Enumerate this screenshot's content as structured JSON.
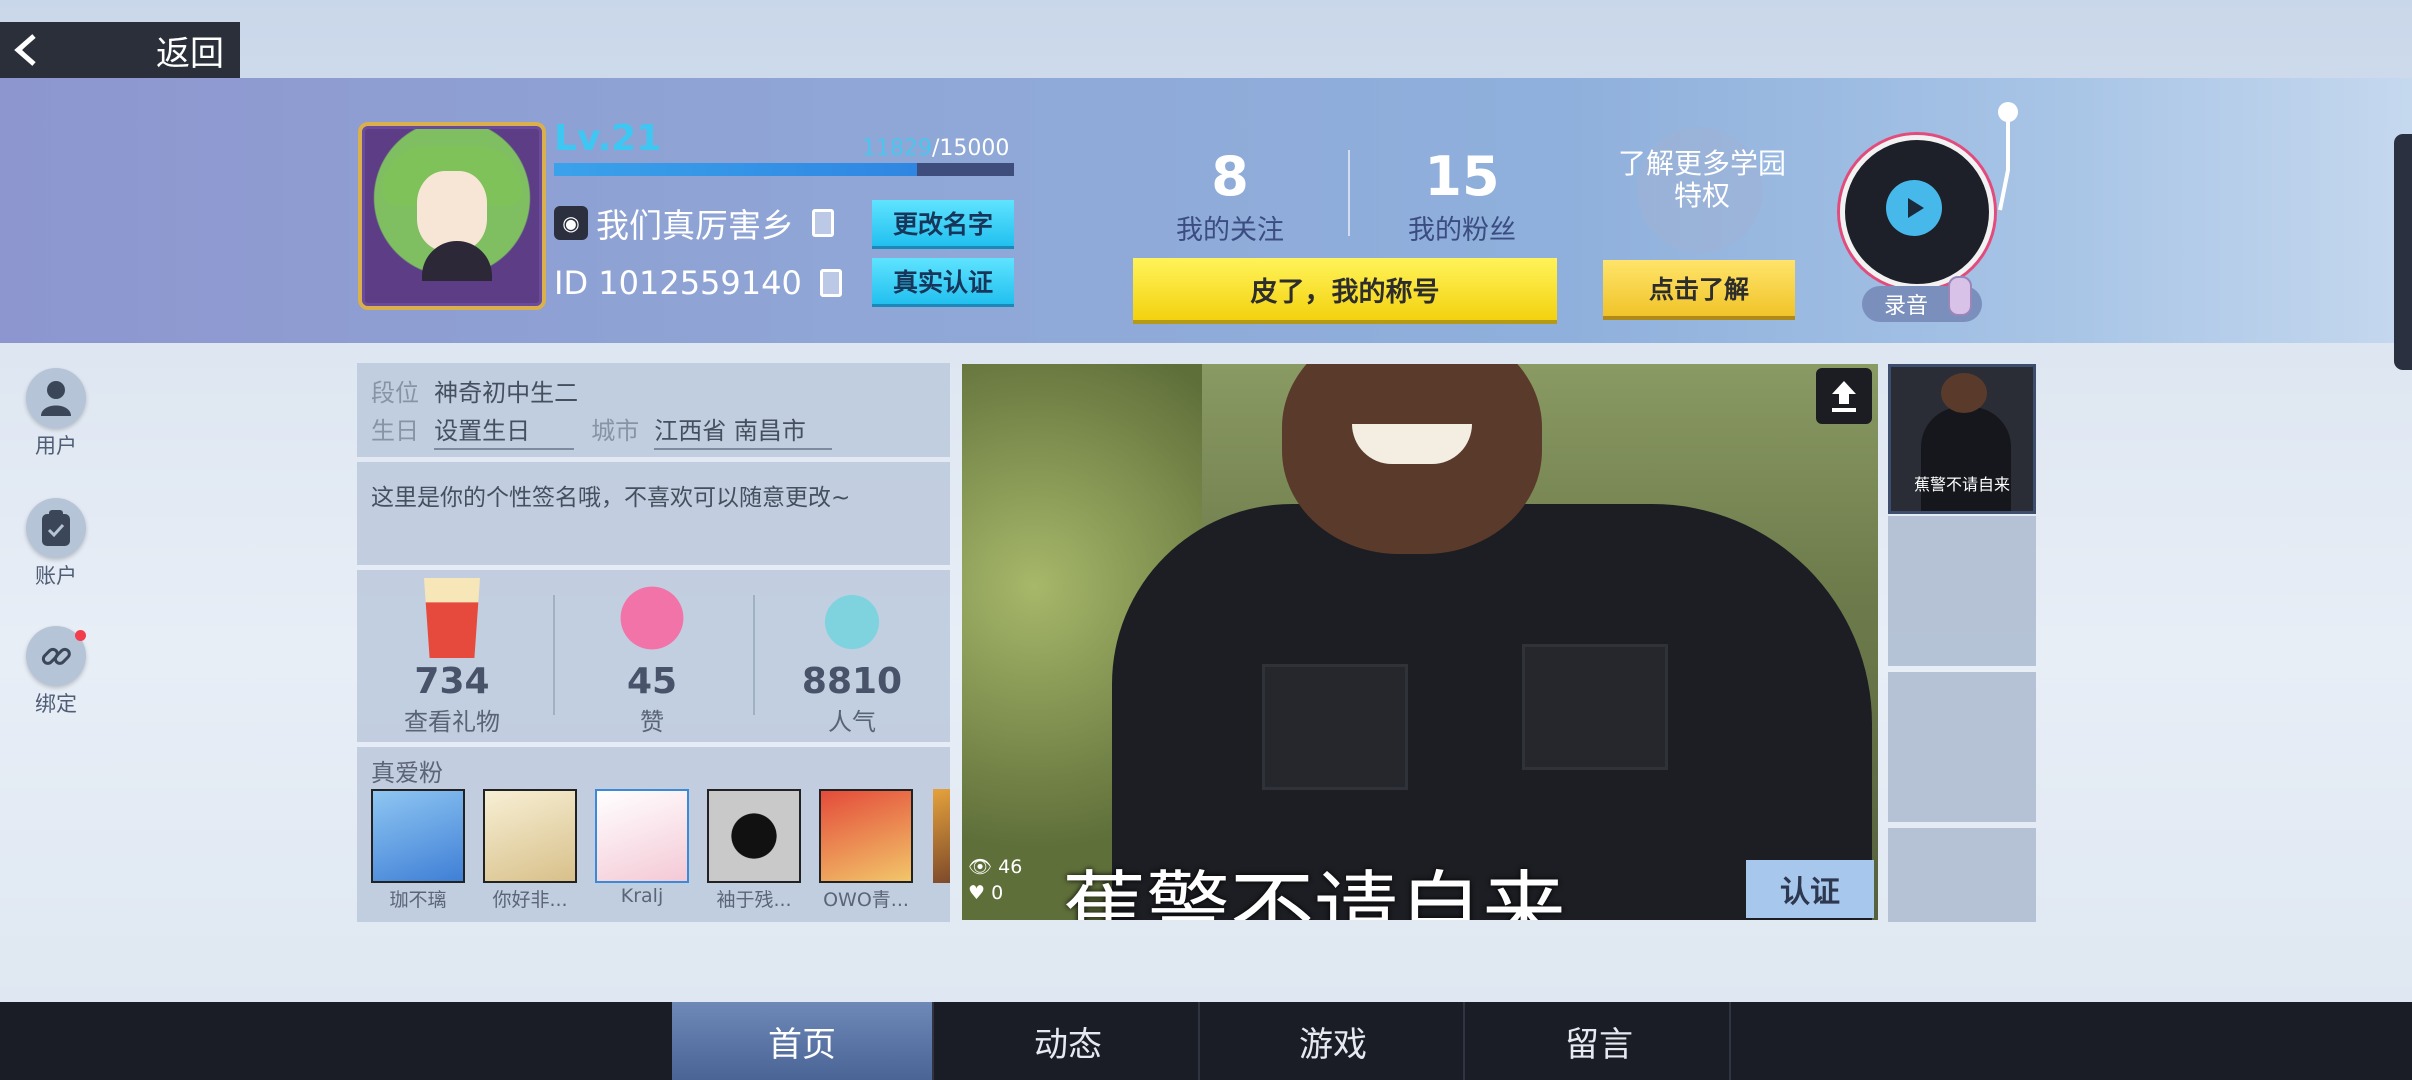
{
  "back": {
    "label": "返回"
  },
  "profile": {
    "level": "Lv.21",
    "xp_current": "11829",
    "xp_max": "/15000",
    "xp_fraction": 0.79,
    "name": "我们真厉害乡",
    "id": "ID 1012559140",
    "rename_label": "更改名字",
    "verify_label": "真实认证"
  },
  "stats": {
    "following_count": "8",
    "following_label": "我的关注",
    "fans_count": "15",
    "fans_label": "我的粉丝",
    "title_button": "皮了，我的称号"
  },
  "privilege": {
    "text": "了解更多学园特权",
    "button": "点击了解"
  },
  "record": {
    "label": "录音"
  },
  "sidebar": {
    "items": [
      {
        "label": "用户",
        "icon": "user-icon"
      },
      {
        "label": "账户",
        "icon": "clipboard-icon"
      },
      {
        "label": "绑定",
        "icon": "link-icon"
      }
    ]
  },
  "info": {
    "rank_label": "段位",
    "rank_value": "神奇初中生二",
    "birthday_label": "生日",
    "birthday_value": "设置生日",
    "city_label": "城市",
    "city_value": "江西省 南昌市",
    "signature": "这里是你的个性签名哦，不喜欢可以随意更改~"
  },
  "gifts": [
    {
      "value": "734",
      "label": "查看礼物",
      "icon": "popcorn-icon"
    },
    {
      "value": "45",
      "label": "赞",
      "icon": "heart-mascot-icon"
    },
    {
      "value": "8810",
      "label": "人气",
      "icon": "bird-mascot-icon"
    }
  ],
  "true_fans": {
    "title": "真爱粉",
    "items": [
      {
        "name": "珈不璃"
      },
      {
        "name": "你好非..."
      },
      {
        "name": "Kralj"
      },
      {
        "name": "袖于残..."
      },
      {
        "name": "OWO青..."
      }
    ]
  },
  "photo": {
    "caption": "蕉警不请自来",
    "views": "46",
    "likes": "0",
    "verify_label": "认证"
  },
  "thumbnails": [
    {
      "caption": "蕉警不请自来"
    }
  ],
  "tabs": [
    {
      "label": "首页",
      "active": true
    },
    {
      "label": "动态"
    },
    {
      "label": "游戏"
    },
    {
      "label": "留言"
    }
  ],
  "colors": {
    "accent_cyan": "#3ec7f2",
    "yellow_button": "#f3d20f",
    "nav_bg": "#1a1d25",
    "active_tab": "#5a77a8"
  }
}
